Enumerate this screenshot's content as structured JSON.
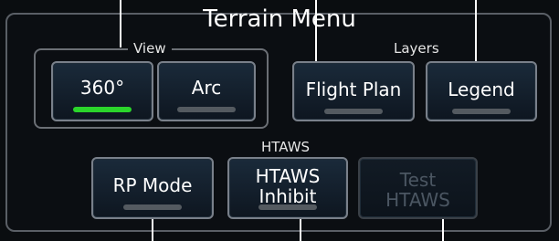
{
  "title": "Terrain Menu",
  "groups": {
    "view": "View",
    "layers": "Layers",
    "htaws": "HTAWS"
  },
  "buttons": {
    "b360": {
      "label": "360°",
      "active": true
    },
    "arc": {
      "label": "Arc",
      "active": false
    },
    "flight_plan": {
      "label": "Flight Plan",
      "active": false
    },
    "legend": {
      "label": "Legend",
      "active": false
    },
    "rp_mode": {
      "label": "RP Mode",
      "active": false
    },
    "htaws_inhibit": {
      "label": "HTAWS\nInhibit",
      "active": false
    },
    "test_htaws": {
      "label": "Test\nHTAWS",
      "enabled": false
    }
  },
  "colors": {
    "indicator_on": "#2bd52b",
    "indicator_off": "#545a60",
    "button_border": "#79808a",
    "disabled_text": "#4b5662"
  }
}
